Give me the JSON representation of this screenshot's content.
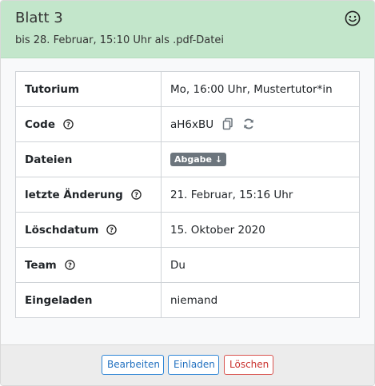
{
  "header": {
    "title": "Blatt 3",
    "subtitle": "bis 28. Februar, 15:10 Uhr als .pdf-Datei",
    "status_icon": "smiley-icon"
  },
  "table": {
    "rows": [
      {
        "label": "Tutorium",
        "value": "Mo, 16:00 Uhr, Mustertutor*in"
      },
      {
        "label": "Code",
        "value": "aH6xBU"
      },
      {
        "label": "Dateien",
        "badge": "Abgabe ↓"
      },
      {
        "label": "letzte Änderung",
        "value": "21. Februar, 15:16 Uhr"
      },
      {
        "label": "Löschdatum",
        "value": "15. Oktober 2020"
      },
      {
        "label": "Team",
        "value": "Du"
      },
      {
        "label": "Eingeladen",
        "value": "niemand"
      }
    ]
  },
  "footer": {
    "edit_label": "Bearbeiten",
    "invite_label": "Einladen",
    "delete_label": "Löschen"
  },
  "colors": {
    "header_bg": "#c3e6cb",
    "primary": "#2f86d6",
    "danger": "#d9534f",
    "badge": "#6c757d"
  }
}
